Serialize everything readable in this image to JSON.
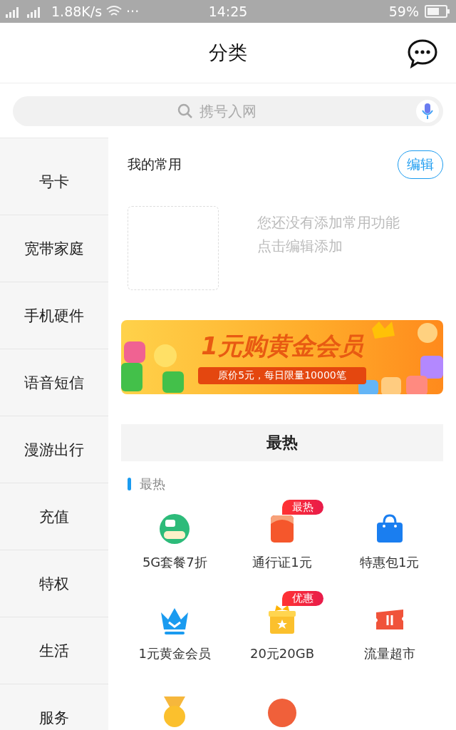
{
  "status_bar": {
    "speed": "1.88K/s",
    "more": "···",
    "time": "14:25",
    "battery": "59%"
  },
  "header": {
    "title": "分类"
  },
  "search": {
    "placeholder": "携号入网"
  },
  "sidebar": {
    "items": [
      {
        "label": "号卡",
        "selected": false
      },
      {
        "label": "宽带家庭",
        "selected": false
      },
      {
        "label": "手机硬件",
        "selected": false
      },
      {
        "label": "语音短信",
        "selected": false
      },
      {
        "label": "漫游出行",
        "selected": false
      },
      {
        "label": "充值",
        "selected": false
      },
      {
        "label": "特权",
        "selected": false
      },
      {
        "label": "生活",
        "selected": false
      },
      {
        "label": "服务",
        "selected": false
      }
    ]
  },
  "favorites": {
    "title": "我的常用",
    "edit_button": "编辑",
    "empty_hint": [
      "您还没有添加常用功能",
      "点击编辑添加"
    ]
  },
  "banner": {
    "title": "1元购黄金会员",
    "subtitle": "原价5元，每日限量10000笔"
  },
  "section": {
    "title": "最热",
    "subtitle": "最热",
    "items": [
      {
        "kind": "plan",
        "label": "5G套餐7折"
      },
      {
        "kind": "pass",
        "label": "通行证1元",
        "badge": "最热"
      },
      {
        "kind": "bag",
        "label": "特惠包1元"
      },
      {
        "kind": "crown",
        "label": "1元黄金会员"
      },
      {
        "kind": "gift",
        "label": "20元20GB",
        "badge": "优惠"
      },
      {
        "kind": "ticket",
        "label": "流量超市"
      },
      {
        "kind": "medal"
      },
      {
        "kind": "app"
      }
    ]
  }
}
